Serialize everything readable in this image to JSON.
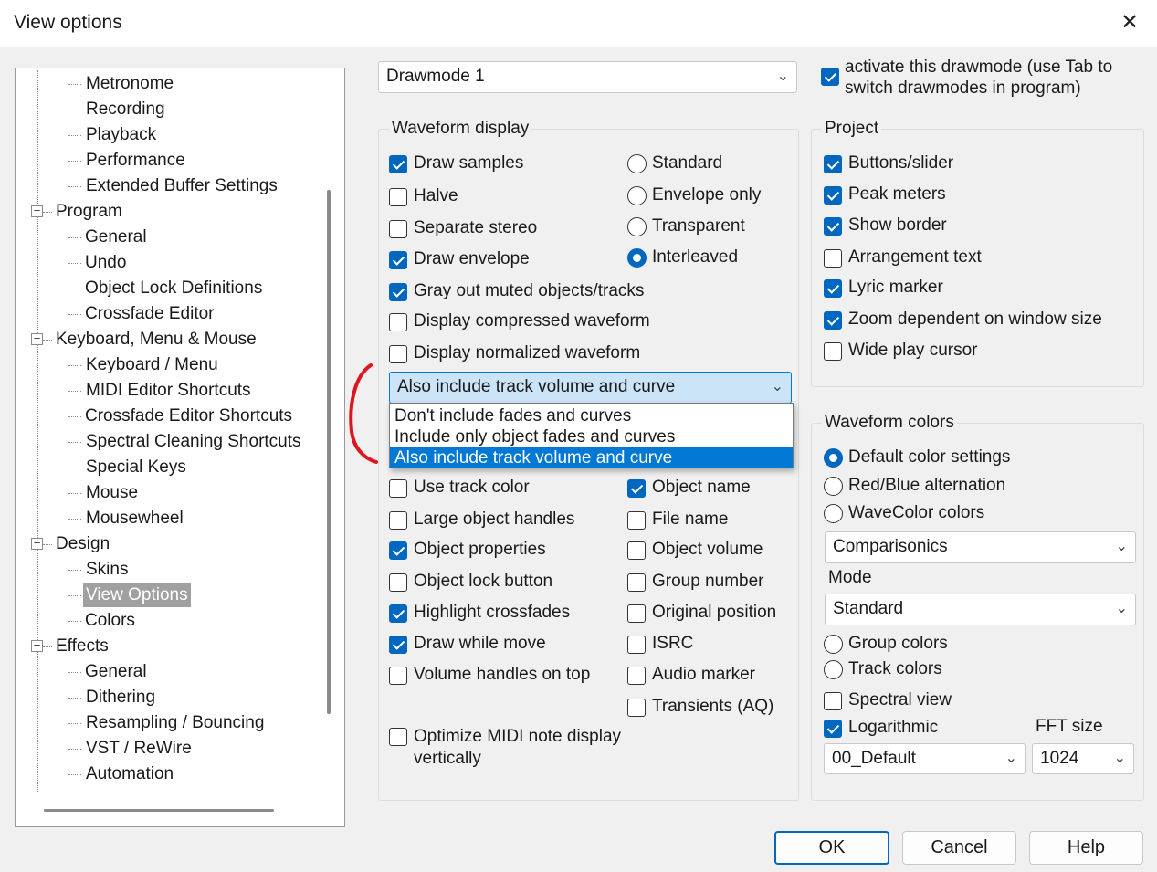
{
  "window": {
    "title": "View options"
  },
  "tree": {
    "items": [
      {
        "label": "Metronome"
      },
      {
        "label": "Recording"
      },
      {
        "label": "Playback"
      },
      {
        "label": "Performance"
      },
      {
        "label": "Extended Buffer Settings"
      },
      {
        "label": "Program"
      },
      {
        "label": "General"
      },
      {
        "label": "Undo"
      },
      {
        "label": "Object Lock Definitions"
      },
      {
        "label": "Crossfade Editor"
      },
      {
        "label": "Keyboard, Menu & Mouse"
      },
      {
        "label": "Keyboard / Menu"
      },
      {
        "label": "MIDI Editor Shortcuts"
      },
      {
        "label": "Crossfade Editor Shortcuts"
      },
      {
        "label": "Spectral Cleaning Shortcuts"
      },
      {
        "label": "Special Keys"
      },
      {
        "label": "Mouse"
      },
      {
        "label": "Mousewheel"
      },
      {
        "label": "Design"
      },
      {
        "label": "Skins"
      },
      {
        "label": "View Options"
      },
      {
        "label": "Colors"
      },
      {
        "label": "Effects"
      },
      {
        "label": "General"
      },
      {
        "label": "Dithering"
      },
      {
        "label": "Resampling / Bouncing"
      },
      {
        "label": "VST / ReWire"
      },
      {
        "label": "Automation"
      }
    ]
  },
  "drawmode": {
    "selected": "Drawmode 1",
    "activate_label": "activate this drawmode (use Tab to switch drawmodes in program)",
    "activate_line1": "activate this drawmode (use Tab to",
    "activate_line2": "switch drawmodes in program)"
  },
  "waveform_display": {
    "title": "Waveform display",
    "draw_samples": "Draw samples",
    "halve": "Halve",
    "separate_stereo": "Separate stereo",
    "draw_envelope": "Draw envelope",
    "gray_out": "Gray out muted objects/tracks",
    "display_compressed": "Display compressed waveform",
    "display_normalized": "Display normalized waveform",
    "standard": "Standard",
    "envelope_only": "Envelope only",
    "transparent": "Transparent",
    "interleaved": "Interleaved"
  },
  "fades_combo": {
    "selected": "Also include track volume and curve",
    "options": [
      "Don't include fades and curves",
      "Include only object fades and curves",
      "Also include track volume and curve"
    ]
  },
  "objects": {
    "use_track_color": "Use track color",
    "large_object_handles": "Large object handles",
    "object_properties": "Object properties",
    "object_lock_button": "Object lock button",
    "highlight_crossfades": "Highlight crossfades",
    "draw_while_move": "Draw while move",
    "volume_handles_on_top": "Volume handles on top",
    "optimize_midi_line1": "Optimize MIDI note display",
    "optimize_midi_line2": "vertically",
    "object_name": "Object name",
    "file_name": "File name",
    "object_volume": "Object volume",
    "group_number": "Group number",
    "original_position": "Original position",
    "isrc": "ISRC",
    "audio_marker": "Audio marker",
    "transients": "Transients (AQ)"
  },
  "project": {
    "title": "Project",
    "buttons_slider": "Buttons/slider",
    "peak_meters": "Peak meters",
    "show_border": "Show border",
    "arrangement_text": "Arrangement text",
    "lyric_marker": "Lyric marker",
    "zoom_dependent": "Zoom dependent on window size",
    "wide_play_cursor": "Wide play cursor"
  },
  "waveform_colors": {
    "title": "Waveform colors",
    "default_color": "Default color settings",
    "red_blue": "Red/Blue alternation",
    "wavecolor": "WaveColor colors",
    "color_scheme": "Comparisonics",
    "mode_label": "Mode",
    "mode_value": "Standard",
    "group_colors": "Group colors",
    "track_colors": "Track colors",
    "spectral_view": "Spectral view",
    "logarithmic": "Logarithmic",
    "fft_label": "FFT size",
    "preset_value": "00_Default",
    "fft_value": "1024"
  },
  "buttons": {
    "ok": "OK",
    "cancel": "Cancel",
    "help": "Help"
  },
  "colors": {
    "accent": "#0067c0",
    "highlight": "#0078d4",
    "annotation": "#e0141e"
  }
}
